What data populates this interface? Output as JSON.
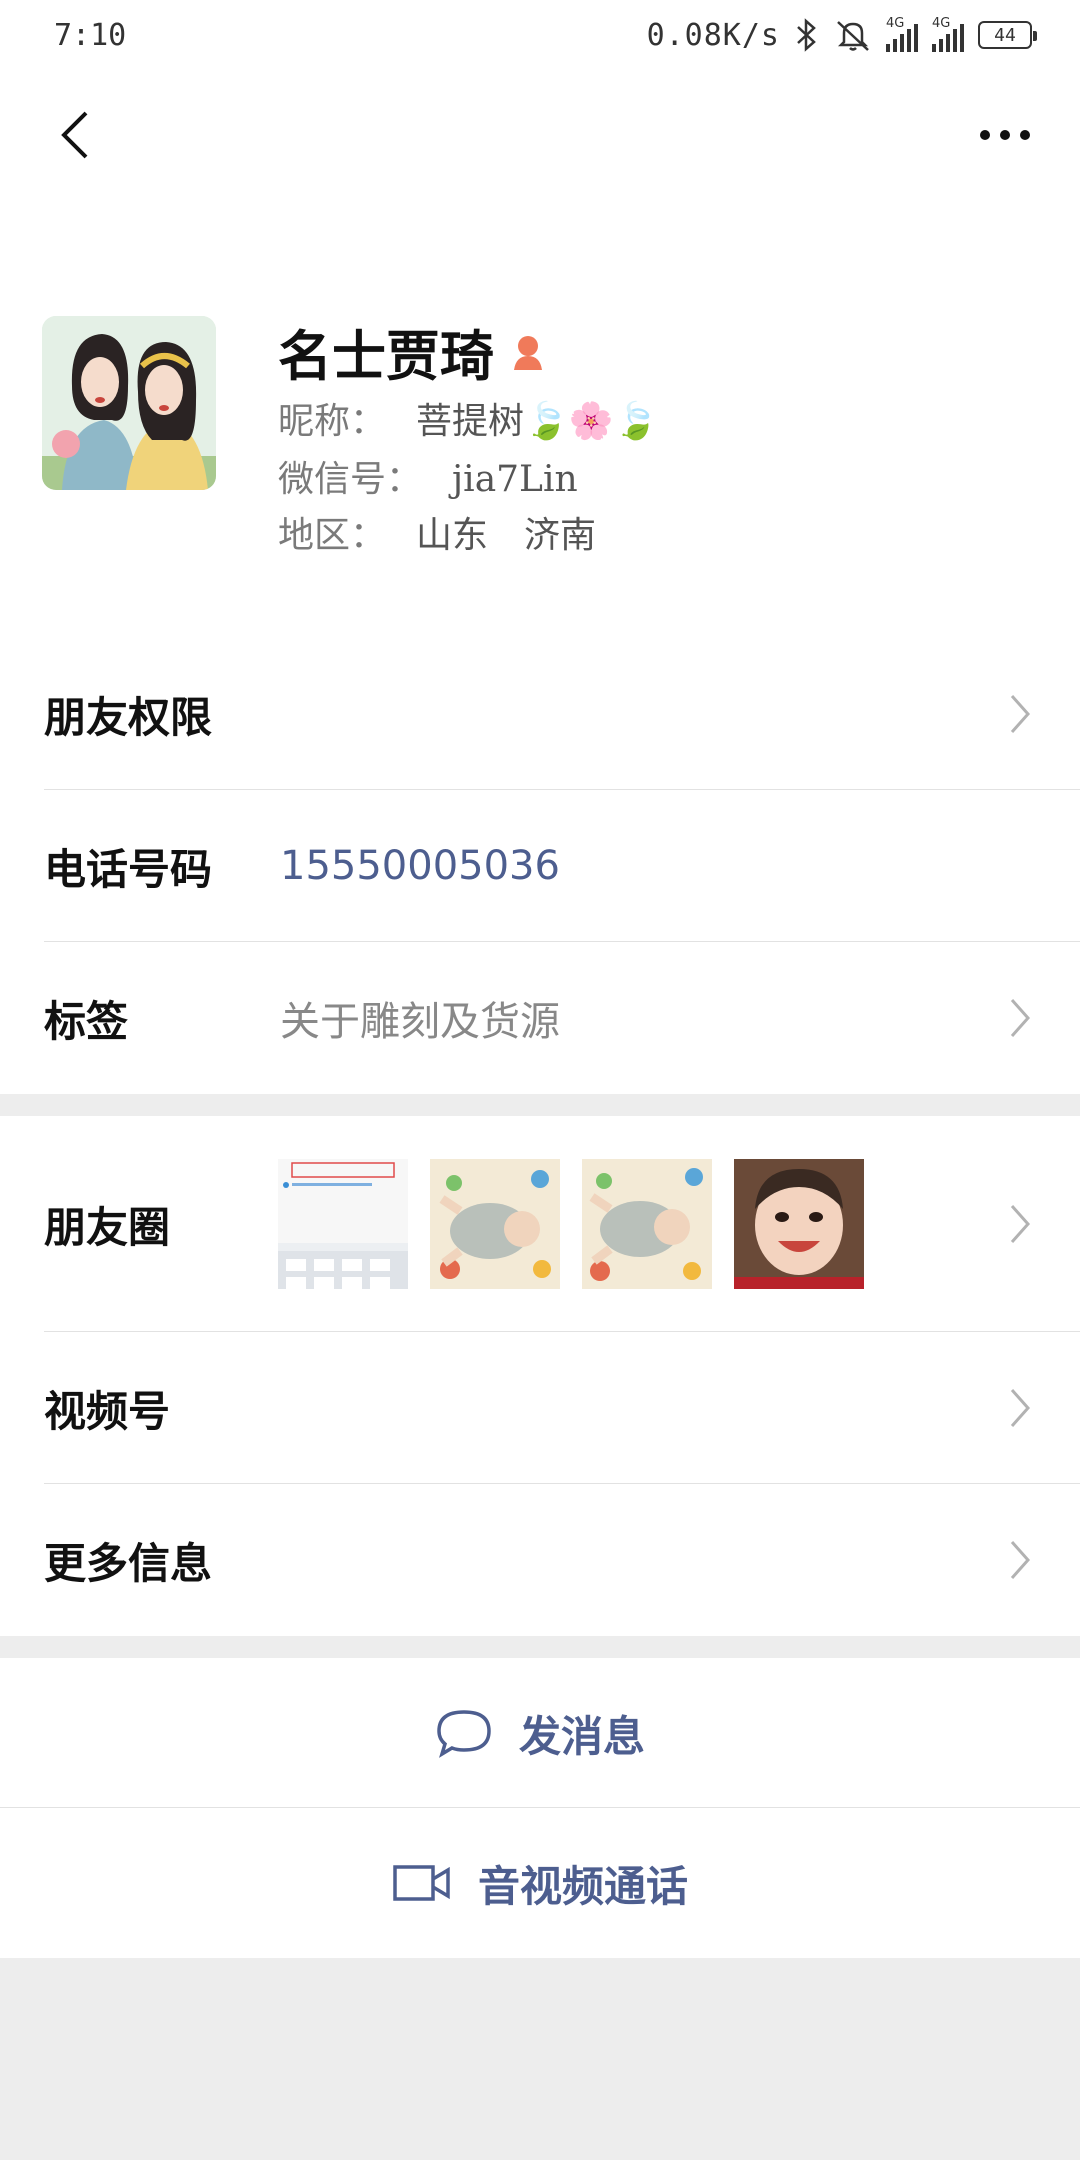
{
  "status_bar": {
    "time": "7:10",
    "net_speed": "0.08K/s",
    "signal1_label": "4G",
    "signal2_label": "4G",
    "battery": "44"
  },
  "nav": {
    "back_icon": "chevron-left-icon",
    "more_icon": "more-dots-icon"
  },
  "profile": {
    "name": "名士贾琦",
    "gender_icon": "female-icon",
    "nickname_label": "昵称：",
    "nickname_value": "菩提树🍃🌸🍃",
    "wechat_id_label": "微信号：",
    "wechat_id_value": "jia7Lin",
    "region_label": "地区：",
    "region_value": "山东　济南"
  },
  "rows_top": {
    "friend_permission": "朋友权限",
    "phone_label": "电话号码",
    "phone_value": "15550005036",
    "tags_label": "标签",
    "tags_value": "关于雕刻及货源"
  },
  "rows_mid": {
    "moments_label": "朋友圈",
    "channels_label": "视频号",
    "more_info_label": "更多信息"
  },
  "actions": {
    "send_message": "发消息",
    "video_call": "音视频通话"
  },
  "colors": {
    "accent": "#4d5e8f",
    "background": "#ededed",
    "gender_female": "#f07a5a"
  }
}
